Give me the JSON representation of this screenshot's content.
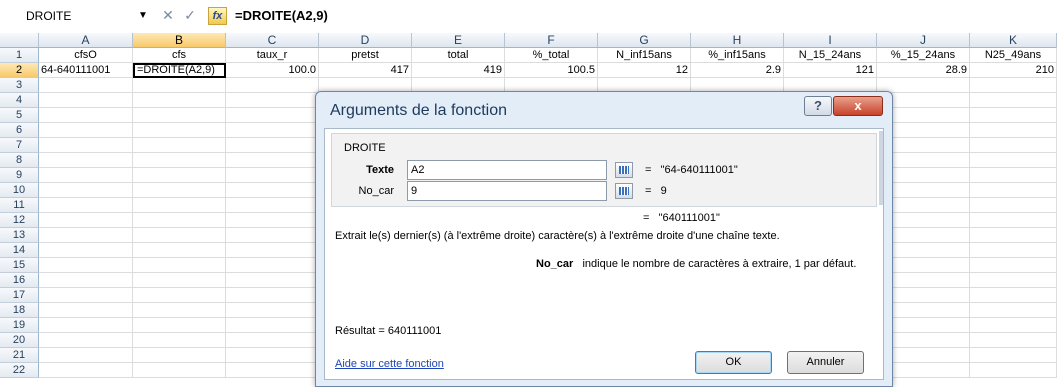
{
  "namebox": "DROITE",
  "formula": "=DROITE(A2,9)",
  "fx_label": "fx",
  "columns": [
    "A",
    "B",
    "C",
    "D",
    "E",
    "F",
    "G",
    "H",
    "I",
    "J",
    "K"
  ],
  "rows": [
    "1",
    "2",
    "3",
    "4",
    "5",
    "6",
    "7",
    "8",
    "9",
    "10",
    "11",
    "12",
    "13",
    "14",
    "15",
    "16",
    "17",
    "18",
    "19",
    "20",
    "21",
    "22"
  ],
  "header_row": [
    "cfsO",
    "cfs",
    "taux_r",
    "pretst",
    "total",
    "%_total",
    "N_inf15ans",
    "%_inf15ans",
    "N_15_24ans",
    "%_15_24ans",
    "N25_49ans"
  ],
  "data_row": [
    "64-640111001",
    "=DROITE(A2,9)",
    "100.0",
    "417",
    "419",
    "100.5",
    "12",
    "2.9",
    "121",
    "28.9",
    "210"
  ],
  "dialog": {
    "title": "Arguments de la fonction",
    "help_btn": "?",
    "close_btn": "x",
    "function_name": "DROITE",
    "args": [
      {
        "label": "Texte",
        "input": "A2",
        "result": "\"64-640111001\""
      },
      {
        "label": "No_car",
        "input": "9",
        "result": "9"
      }
    ],
    "equals": "=",
    "formula_result": "\"640111001\"",
    "description": "Extrait le(s) dernier(s) (à l'extrême droite) caractère(s) à l'extrême droite d'une chaîne texte.",
    "arg_name": "No_car",
    "arg_desc": "indique le nombre de caractères à extraire, 1 par défaut.",
    "result_line": "Résultat =  640111001",
    "help_link": "Aide sur cette fonction",
    "ok": "OK",
    "cancel": "Annuler"
  }
}
